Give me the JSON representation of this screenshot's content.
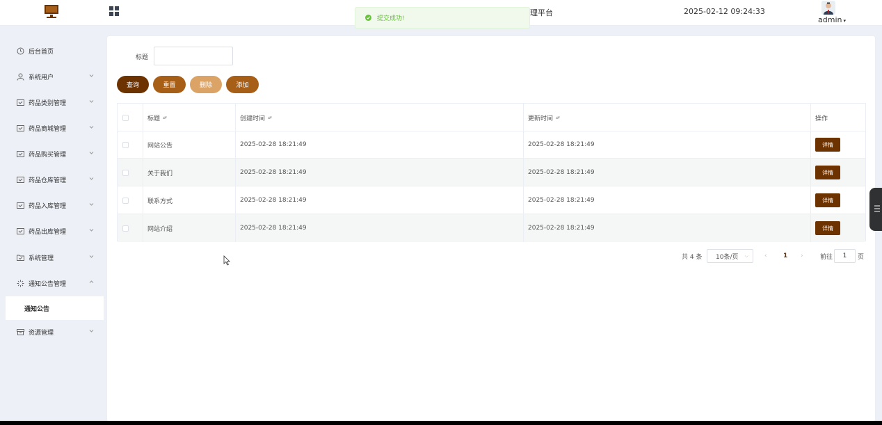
{
  "header": {
    "title": "理平台",
    "datetime": "2025-02-12 09:24:33",
    "username": "admin"
  },
  "toast": {
    "message": "提交成功!"
  },
  "sidebar": {
    "items": [
      {
        "label": "后台首页",
        "icon": "clock-icon"
      },
      {
        "label": "系统用户",
        "icon": "user-icon"
      },
      {
        "label": "药品类别管理",
        "icon": "panel-icon"
      },
      {
        "label": "药品商城管理",
        "icon": "panel-icon"
      },
      {
        "label": "药品购买管理",
        "icon": "panel-icon"
      },
      {
        "label": "药品仓库管理",
        "icon": "panel-icon"
      },
      {
        "label": "药品入库管理",
        "icon": "panel-icon"
      },
      {
        "label": "药品出库管理",
        "icon": "panel-icon"
      },
      {
        "label": "系统管理",
        "icon": "folder-icon"
      },
      {
        "label": "通知公告管理",
        "icon": "loading-icon"
      },
      {
        "label": "资源管理",
        "icon": "box-icon"
      }
    ],
    "active_sub": "通知公告"
  },
  "search": {
    "label": "标题",
    "value": ""
  },
  "buttons": {
    "query": "查询",
    "reset": "重置",
    "delete": "删除",
    "add": "添加"
  },
  "table": {
    "headers": {
      "title": "标题",
      "created": "创建时间",
      "updated": "更新时间",
      "action": "操作"
    },
    "rows": [
      {
        "title": "网站公告",
        "created": "2025-02-28 18:21:49",
        "updated": "2025-02-28 18:21:49",
        "action": "详情"
      },
      {
        "title": "关于我们",
        "created": "2025-02-28 18:21:49",
        "updated": "2025-02-28 18:21:49",
        "action": "详情"
      },
      {
        "title": "联系方式",
        "created": "2025-02-28 18:21:49",
        "updated": "2025-02-28 18:21:49",
        "action": "详情"
      },
      {
        "title": "网站介绍",
        "created": "2025-02-28 18:21:49",
        "updated": "2025-02-28 18:21:49",
        "action": "详情"
      }
    ]
  },
  "pagination": {
    "total": "共 4 条",
    "page_size": "10条/页",
    "current": "1",
    "goto_label": "前往",
    "goto_value": "1",
    "goto_suffix": "页"
  },
  "colors": {
    "primary": "#6c3200",
    "accent": "#a75e16",
    "light_accent": "#dba466",
    "success": "#67c23a"
  }
}
